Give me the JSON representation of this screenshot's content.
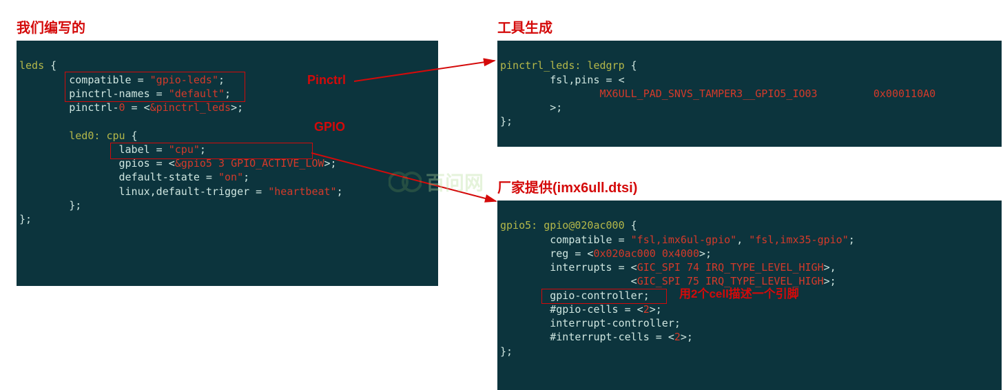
{
  "left": {
    "heading": "我们编写的",
    "annot_pinctrl": "Pinctrl",
    "annot_gpio": "GPIO",
    "code": {
      "l1a": "leds",
      "l1b": " {",
      "l2a": "        compatible = ",
      "l2b": "\"gpio-leds\"",
      "l2c": ";",
      "l3a": "        pinctrl-names = ",
      "l3b": "\"default\"",
      "l3c": ";",
      "l4a": "        pinctrl-",
      "l4b": "0",
      "l4c": " = <",
      "l4d": "&pinctrl_leds",
      "l4e": ">;",
      "l5": "",
      "l6a": "        ",
      "l6b": "led0:",
      "l6c": " ",
      "l6d": "cpu",
      "l6e": " {",
      "l7a": "                label = ",
      "l7b": "\"cpu\"",
      "l7c": ";",
      "l8a": "                gpios = <",
      "l8b": "&gpio5",
      "l8c": " ",
      "l8d": "3",
      "l8e": " ",
      "l8f": "GPIO_ACTIVE_LOW",
      "l8g": ">;",
      "l9a": "                default-state = ",
      "l9b": "\"on\"",
      "l9c": ";",
      "l10a": "                linux,default-trigger = ",
      "l10b": "\"heartbeat\"",
      "l10c": ";",
      "l11": "        };",
      "l12": "};"
    }
  },
  "rightTop": {
    "heading": "工具生成",
    "code": {
      "l1a": "pinctrl_leds:",
      "l1b": " ",
      "l1c": "ledgrp",
      "l1d": " {",
      "l2": "        fsl,pins = <",
      "l3a": "                ",
      "l3b": "MX6ULL_PAD_SNVS_TAMPER3__GPIO5_IO03",
      "l3c": "         ",
      "l3d": "0x000110A0",
      "l4": "        >;",
      "l5": "};"
    }
  },
  "rightBottom": {
    "heading": "厂家提供(imx6ull.dtsi)",
    "annot_cells": "用2个cell描述一个引脚",
    "code": {
      "l1a": "gpio5:",
      "l1b": " ",
      "l1c": "gpio@020ac000",
      "l1d": " {",
      "l2a": "        compatible = ",
      "l2b": "\"fsl,imx6ul-gpio\"",
      "l2c": ", ",
      "l2d": "\"fsl,imx35-gpio\"",
      "l2e": ";",
      "l3a": "        reg = <",
      "l3b": "0x020ac000",
      "l3c": " ",
      "l3d": "0x4000",
      "l3e": ">;",
      "l4a": "        interrupts = <",
      "l4b": "GIC_SPI",
      "l4c": " ",
      "l4d": "74",
      "l4e": " ",
      "l4f": "IRQ_TYPE_LEVEL_HIGH",
      "l4g": ">,",
      "l5a": "                     <",
      "l5b": "GIC_SPI",
      "l5c": " ",
      "l5d": "75",
      "l5e": " ",
      "l5f": "IRQ_TYPE_LEVEL_HIGH",
      "l5g": ">;",
      "l6": "        gpio-controller;",
      "l7a": "        #gpio-cells = <",
      "l7b": "2",
      "l7c": ">;",
      "l8": "        interrupt-controller;",
      "l9a": "        #interrupt-cells = <",
      "l9b": "2",
      "l9c": ">;",
      "l10": "};"
    }
  },
  "watermark": "百问网"
}
